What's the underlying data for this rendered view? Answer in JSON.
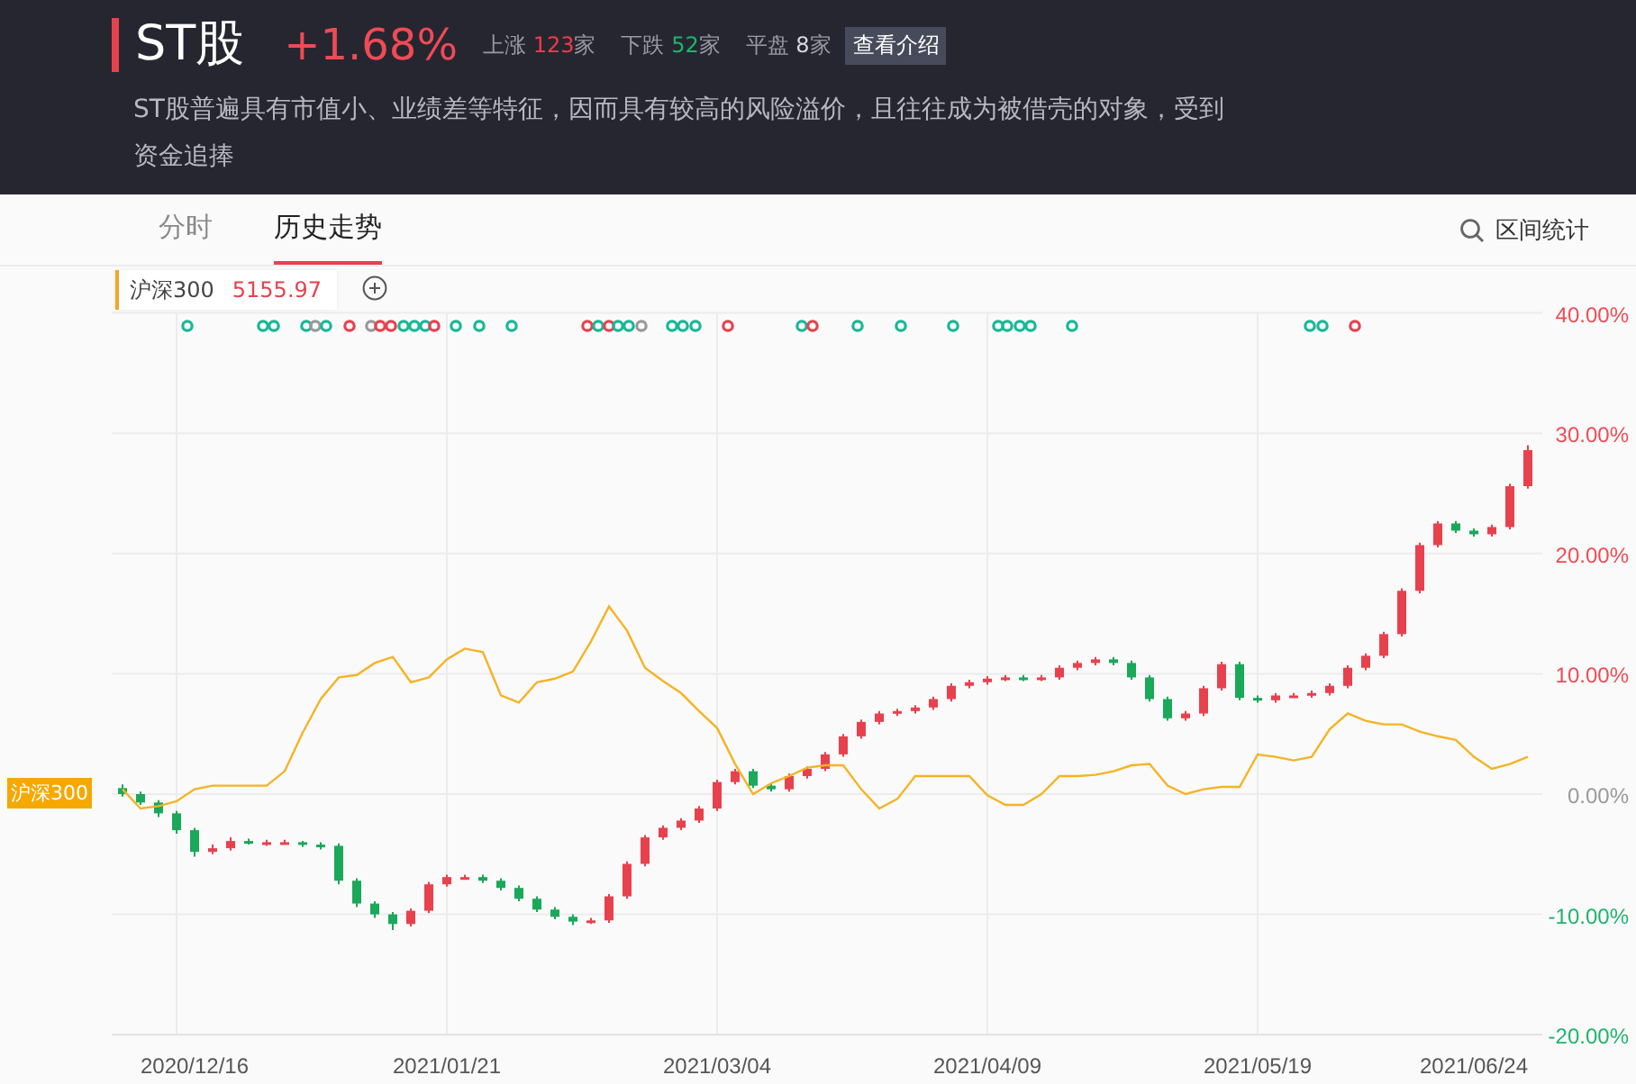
{
  "header": {
    "title": "ST股",
    "change": "+1.68%",
    "stats": [
      {
        "label": "上涨",
        "value": "123",
        "unit": "家",
        "kind": "up"
      },
      {
        "label": "下跌",
        "value": "52",
        "unit": "家",
        "kind": "down"
      },
      {
        "label": "平盘",
        "value": "8",
        "unit": "家",
        "kind": "flat"
      }
    ],
    "intro_button": "查看介绍",
    "description": "ST股普遍具有市值小、业绩差等特征，因而具有较高的风险溢价，且往往成为被借壳的对象，受到资金追捧"
  },
  "tabs": [
    {
      "label": "分时",
      "selected": false
    },
    {
      "label": "历史走势",
      "selected": true
    }
  ],
  "range_stats": "区间统计",
  "legend_value": "5155.97",
  "index_tag": "沪深300",
  "event_markers": [
    {
      "color": "#17b897"
    },
    {
      "color": "#17b897"
    },
    {
      "color": "#17b897"
    },
    {
      "color": "#17b897"
    },
    {
      "color": "#999999"
    },
    {
      "color": "#17b897"
    },
    {
      "color": "#e8414e"
    },
    {
      "color": "#999999"
    },
    {
      "color": "#e8414e"
    },
    {
      "color": "#e8414e"
    },
    {
      "color": "#17b897"
    },
    {
      "color": "#17b897"
    },
    {
      "color": "#17b897"
    },
    {
      "color": "#e8414e"
    },
    {
      "color": "#17b897"
    },
    {
      "color": "#17b897"
    },
    {
      "color": "#17b897"
    },
    {
      "color": "#e8414e"
    },
    {
      "color": "#17b897"
    },
    {
      "color": "#e8414e"
    },
    {
      "color": "#17b897"
    },
    {
      "color": "#17b897"
    },
    {
      "color": "#999999"
    },
    {
      "color": "#17b897"
    },
    {
      "color": "#17b897"
    },
    {
      "color": "#17b897"
    },
    {
      "color": "#e8414e"
    },
    {
      "color": "#17b897"
    },
    {
      "color": "#e8414e"
    },
    {
      "color": "#17b897"
    },
    {
      "color": "#17b897"
    },
    {
      "color": "#17b897"
    },
    {
      "color": "#17b897"
    },
    {
      "color": "#17b897"
    },
    {
      "color": "#17b897"
    },
    {
      "color": "#17b897"
    },
    {
      "color": "#17b897"
    },
    {
      "color": "#17b897"
    },
    {
      "color": "#17b897"
    },
    {
      "color": "#e8414e"
    }
  ],
  "chart_data": {
    "type": "candlestick",
    "categories": [
      null,
      null,
      null,
      null,
      "2020/12/16",
      null,
      null,
      null,
      null,
      null,
      null,
      null,
      null,
      null,
      null,
      null,
      null,
      null,
      "2021/01/21",
      null,
      null,
      null,
      null,
      null,
      null,
      null,
      null,
      null,
      null,
      null,
      null,
      null,
      null,
      "2021/03/04",
      null,
      null,
      null,
      null,
      null,
      null,
      null,
      null,
      null,
      null,
      null,
      null,
      null,
      null,
      "2021/04/09",
      null,
      null,
      null,
      null,
      null,
      null,
      null,
      null,
      null,
      null,
      null,
      null,
      null,
      null,
      "2021/05/19",
      null,
      null,
      null,
      null,
      null,
      null,
      null,
      null,
      null,
      null,
      null,
      "2021/06/24",
      null,
      null,
      null
    ],
    "ohlc": [
      [
        0.5,
        0.8,
        -0.2,
        0.0
      ],
      [
        0.0,
        0.2,
        -0.9,
        -0.7
      ],
      [
        -0.7,
        -0.5,
        -1.9,
        -1.6
      ],
      [
        -1.6,
        -1.4,
        -3.3,
        -3.0
      ],
      [
        -3.0,
        -2.8,
        -5.2,
        -4.8
      ],
      [
        -4.8,
        -4.2,
        -5.0,
        -4.5
      ],
      [
        -4.5,
        -3.6,
        -4.7,
        -3.9
      ],
      [
        -3.9,
        -3.7,
        -4.2,
        -4.0
      ],
      [
        -4.0,
        -3.8,
        -4.3,
        -4.0
      ],
      [
        -4.0,
        -3.8,
        -4.2,
        -4.0
      ],
      [
        -4.0,
        -3.9,
        -4.4,
        -4.2
      ],
      [
        -4.2,
        -4.0,
        -4.6,
        -4.3
      ],
      [
        -4.3,
        -4.1,
        -7.5,
        -7.2
      ],
      [
        -7.2,
        -7.0,
        -9.4,
        -9.1
      ],
      [
        -9.1,
        -8.9,
        -10.3,
        -10.0
      ],
      [
        -10.0,
        -9.8,
        -11.3,
        -10.8
      ],
      [
        -10.8,
        -9.5,
        -11.0,
        -9.7
      ],
      [
        -9.7,
        -7.3,
        -9.9,
        -7.5
      ],
      [
        -7.5,
        -6.7,
        -7.7,
        -6.9
      ],
      [
        -6.9,
        -6.7,
        -7.1,
        -6.9
      ],
      [
        -6.9,
        -6.7,
        -7.4,
        -7.2
      ],
      [
        -7.2,
        -7.0,
        -8.0,
        -7.8
      ],
      [
        -7.8,
        -7.6,
        -8.9,
        -8.7
      ],
      [
        -8.7,
        -8.5,
        -9.8,
        -9.6
      ],
      [
        -9.6,
        -9.4,
        -10.4,
        -10.2
      ],
      [
        -10.2,
        -10.0,
        -10.9,
        -10.6
      ],
      [
        -10.6,
        -10.3,
        -10.8,
        -10.5
      ],
      [
        -10.5,
        -8.3,
        -10.7,
        -8.5
      ],
      [
        -8.5,
        -5.6,
        -8.7,
        -5.8
      ],
      [
        -5.8,
        -3.4,
        -6.0,
        -3.6
      ],
      [
        -3.6,
        -2.6,
        -3.8,
        -2.8
      ],
      [
        -2.8,
        -2.0,
        -3.0,
        -2.2
      ],
      [
        -2.2,
        -1.0,
        -2.4,
        -1.2
      ],
      [
        -1.2,
        1.2,
        -1.4,
        1.0
      ],
      [
        1.0,
        2.1,
        0.8,
        1.9
      ],
      [
        1.9,
        2.1,
        0.5,
        0.7
      ],
      [
        0.7,
        0.9,
        0.2,
        0.4
      ],
      [
        0.4,
        1.7,
        0.2,
        1.5
      ],
      [
        1.5,
        2.3,
        1.3,
        2.1
      ],
      [
        2.1,
        3.5,
        1.9,
        3.3
      ],
      [
        3.3,
        5.0,
        3.1,
        4.8
      ],
      [
        4.8,
        6.2,
        4.6,
        6.0
      ],
      [
        6.0,
        6.9,
        5.8,
        6.7
      ],
      [
        6.7,
        7.1,
        6.5,
        6.9
      ],
      [
        6.9,
        7.4,
        6.7,
        7.2
      ],
      [
        7.2,
        8.1,
        7.0,
        7.9
      ],
      [
        7.9,
        9.2,
        7.7,
        9.0
      ],
      [
        9.0,
        9.5,
        8.8,
        9.3
      ],
      [
        9.3,
        9.8,
        9.1,
        9.6
      ],
      [
        9.6,
        9.9,
        9.4,
        9.7
      ],
      [
        9.7,
        9.9,
        9.4,
        9.6
      ],
      [
        9.6,
        9.9,
        9.4,
        9.7
      ],
      [
        9.7,
        10.7,
        9.5,
        10.5
      ],
      [
        10.5,
        11.1,
        10.3,
        10.9
      ],
      [
        10.9,
        11.4,
        10.7,
        11.2
      ],
      [
        11.2,
        11.4,
        10.7,
        10.9
      ],
      [
        10.9,
        11.1,
        9.5,
        9.7
      ],
      [
        9.7,
        9.9,
        7.7,
        7.9
      ],
      [
        7.9,
        8.1,
        6.1,
        6.3
      ],
      [
        6.3,
        6.9,
        6.1,
        6.7
      ],
      [
        6.7,
        9.0,
        6.5,
        8.8
      ],
      [
        8.8,
        11.0,
        8.6,
        10.8
      ],
      [
        10.8,
        11.0,
        7.8,
        8.0
      ],
      [
        8.0,
        8.2,
        7.6,
        7.8
      ],
      [
        7.8,
        8.4,
        7.6,
        8.2
      ],
      [
        8.2,
        8.4,
        8.0,
        8.2
      ],
      [
        8.2,
        8.6,
        8.0,
        8.4
      ],
      [
        8.4,
        9.2,
        8.2,
        9.0
      ],
      [
        9.0,
        10.7,
        8.8,
        10.5
      ],
      [
        10.5,
        11.7,
        10.3,
        11.5
      ],
      [
        11.5,
        13.5,
        11.3,
        13.3
      ],
      [
        13.3,
        17.1,
        13.1,
        16.9
      ],
      [
        16.9,
        20.9,
        16.7,
        20.7
      ],
      [
        20.7,
        22.7,
        20.5,
        22.5
      ],
      [
        22.5,
        22.7,
        21.7,
        21.9
      ],
      [
        21.9,
        22.1,
        21.4,
        21.6
      ],
      [
        21.6,
        22.4,
        21.4,
        22.2
      ],
      [
        22.2,
        25.8,
        22.0,
        25.6
      ],
      [
        25.6,
        29.0,
        25.4,
        28.6
      ]
    ],
    "series": [
      {
        "name": "沪深300",
        "type": "line",
        "color": "#f5b324",
        "values": [
          0.4,
          -1.2,
          -1.0,
          -0.6,
          0.4,
          0.7,
          0.7,
          0.7,
          0.7,
          1.9,
          5.1,
          7.9,
          9.7,
          9.9,
          10.9,
          11.4,
          9.3,
          9.7,
          11.2,
          12.1,
          11.8,
          8.2,
          7.6,
          9.3,
          9.6,
          10.2,
          12.7,
          15.6,
          13.6,
          10.5,
          9.4,
          8.4,
          6.9,
          5.5,
          2.5,
          0.0,
          0.9,
          1.5,
          2.2,
          2.4,
          2.4,
          0.4,
          -1.2,
          -0.4,
          1.5,
          1.5,
          1.5,
          1.5,
          -0.1,
          -0.9,
          -0.9,
          0.0,
          1.5,
          1.5,
          1.6,
          1.9,
          2.4,
          2.5,
          0.7,
          0.0,
          0.4,
          0.6,
          0.6,
          3.3,
          3.1,
          2.8,
          3.1,
          5.4,
          6.7,
          6.1,
          5.8,
          5.8,
          5.2,
          4.8,
          4.5,
          3.1,
          2.1,
          2.5,
          3.1
        ]
      }
    ],
    "ylim": [
      -20,
      40
    ],
    "grid": true,
    "yticks": [
      {
        "value": 40,
        "label": "40.00%"
      },
      {
        "value": 30,
        "label": "30.00%"
      },
      {
        "value": 20,
        "label": "20.00%"
      },
      {
        "value": 10,
        "label": "10.00%"
      },
      {
        "value": 0,
        "label": "0.00%"
      },
      {
        "value": -10,
        "label": "-10.00%"
      },
      {
        "value": -20,
        "label": "-20.00%"
      }
    ]
  }
}
